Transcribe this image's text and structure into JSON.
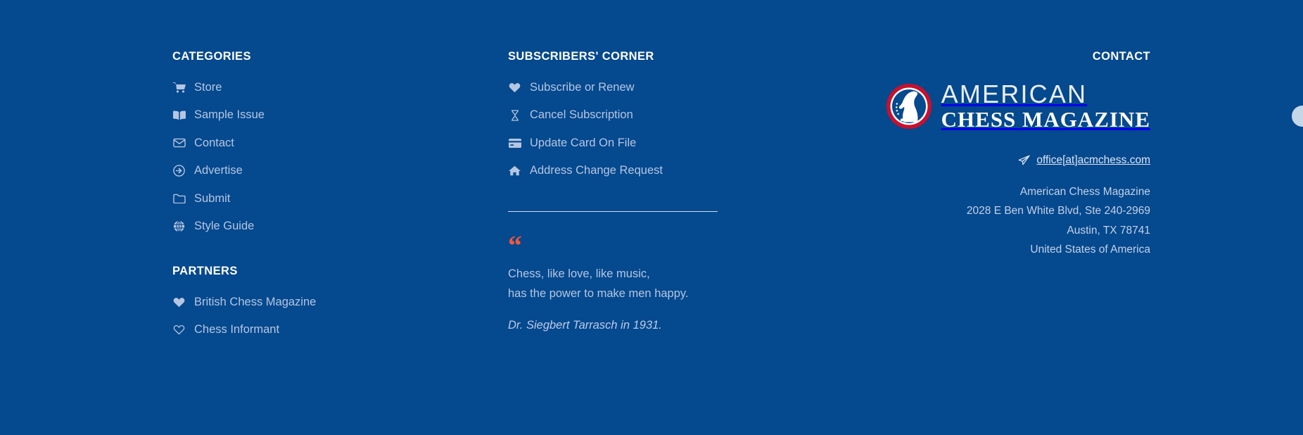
{
  "theme": {
    "background": "#05498e",
    "link_color": "#b5c6e2",
    "heading_color": "#ffffff",
    "accent_quote": "#f4573c",
    "logo_ring": "#c8102e"
  },
  "categories": {
    "heading": "CATEGORIES",
    "items": [
      {
        "label": "Store",
        "icon": "shopping-cart-icon"
      },
      {
        "label": "Sample Issue",
        "icon": "open-book-icon"
      },
      {
        "label": "Contact",
        "icon": "envelope-icon"
      },
      {
        "label": "Advertise",
        "icon": "arrow-circle-right-icon"
      },
      {
        "label": "Submit",
        "icon": "folder-icon"
      },
      {
        "label": "Style Guide",
        "icon": "globe-icon"
      }
    ]
  },
  "partners": {
    "heading": "PARTNERS",
    "items": [
      {
        "label": "British Chess Magazine",
        "icon": "heart-filled-icon"
      },
      {
        "label": "Chess Informant",
        "icon": "heart-outline-icon"
      }
    ]
  },
  "subscribers": {
    "heading": "SUBSCRIBERS' CORNER",
    "items": [
      {
        "label": "Subscribe or Renew",
        "icon": "heart-filled-icon"
      },
      {
        "label": "Cancel Subscription",
        "icon": "hourglass-icon"
      },
      {
        "label": "Update Card On File",
        "icon": "credit-card-icon"
      },
      {
        "label": "Address Change Request",
        "icon": "home-icon"
      }
    ],
    "quote": {
      "mark": "“",
      "line1": "Chess, like love, like music,",
      "line2": "has the power to make men happy.",
      "attribution": "Dr. Siegbert Tarrasch in 1931."
    }
  },
  "contact": {
    "heading": "CONTACT",
    "logo": {
      "line1": "AMERICAN",
      "line2": "CHESS MAGAZINE",
      "badge_icon": "knight-chess-piece-icon"
    },
    "email": {
      "icon": "paper-plane-icon",
      "text": "office[at]acmchess.com"
    },
    "address": [
      "American Chess Magazine",
      "2028 E Ben White Blvd, Ste 240-2969",
      "Austin, TX 78741",
      "United States of America"
    ]
  }
}
